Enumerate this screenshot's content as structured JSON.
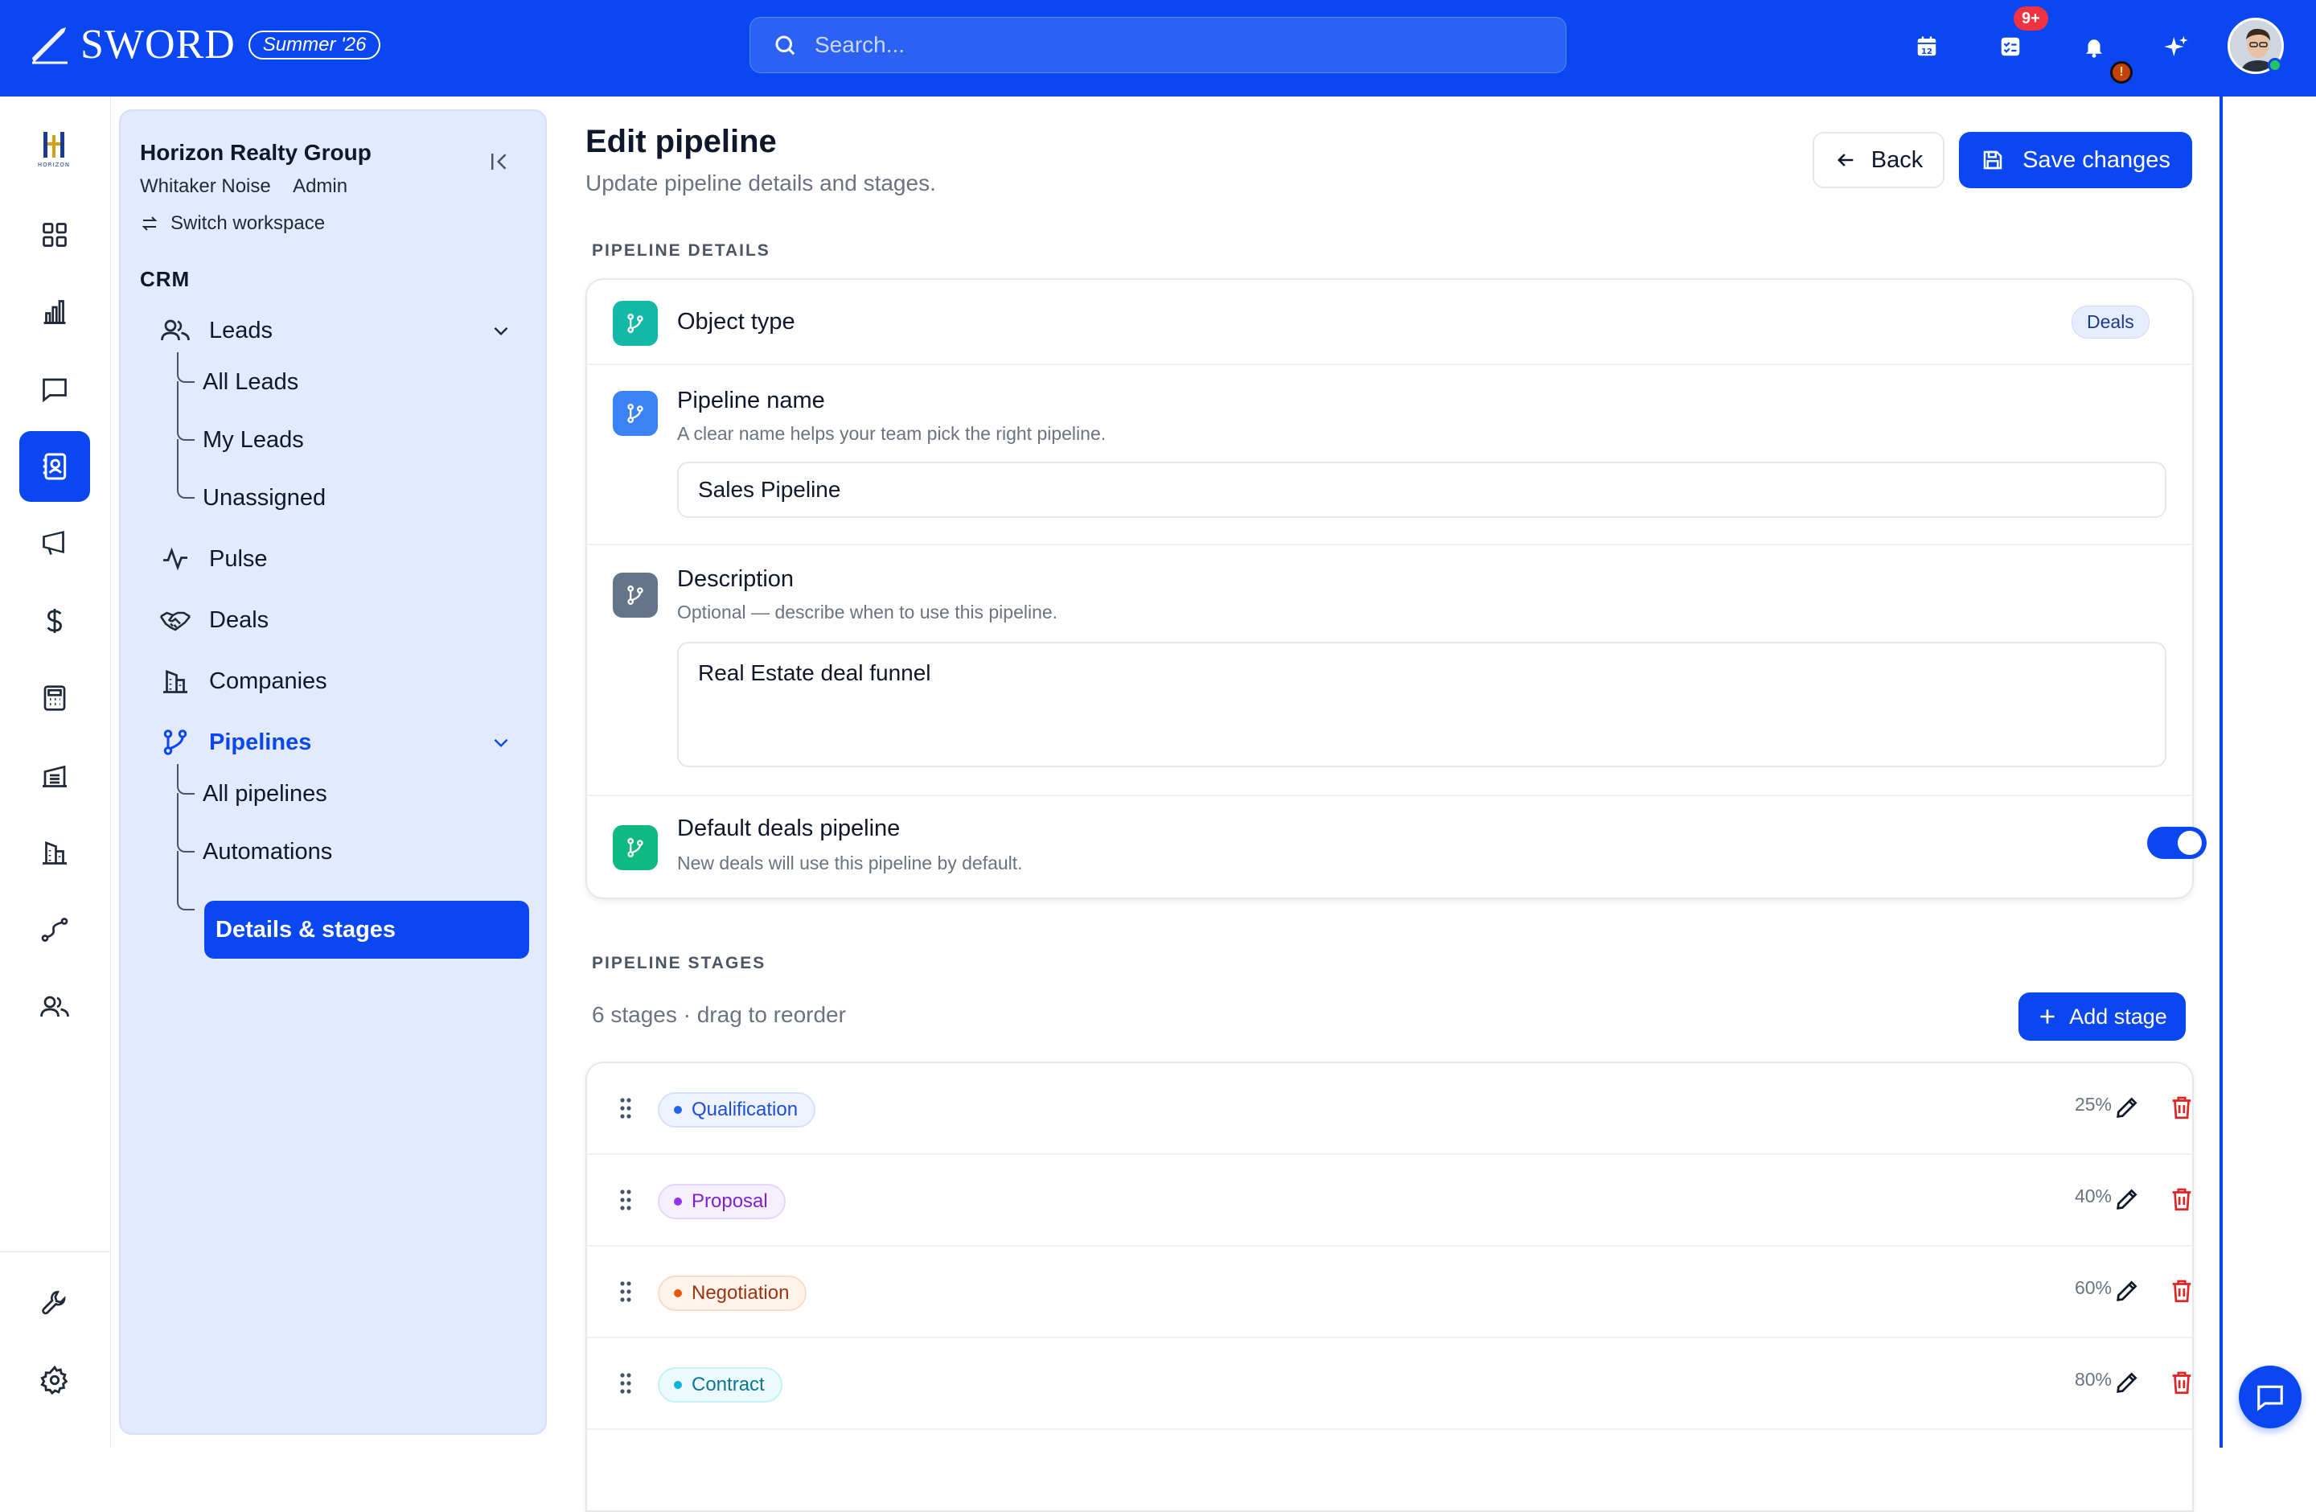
{
  "topbar": {
    "brand": "SWORD",
    "release": "Summer '26",
    "search_placeholder": "Search...",
    "calendar_day": "12",
    "tasks_badge": "9+",
    "alert_badge": "!",
    "accent": "#0a47f0"
  },
  "rail": {
    "logo_text": "HORIZON",
    "items": [
      "dashboard-icon",
      "analytics-icon",
      "messages-icon",
      "contacts-icon",
      "campaigns-icon",
      "finance-icon",
      "calculator-icon",
      "warehouse-icon",
      "buildings-icon",
      "routes-icon",
      "team-icon"
    ],
    "active": "contacts-icon",
    "bottom": [
      "tools-icon",
      "settings-icon"
    ]
  },
  "workspace": {
    "name": "Horizon Realty Group",
    "user": "Whitaker Noise",
    "role": "Admin",
    "switch_label": "Switch workspace",
    "section": "CRM",
    "nav": {
      "leads": "Leads",
      "leads_children": [
        "All Leads",
        "My Leads",
        "Unassigned"
      ],
      "pulse": "Pulse",
      "deals": "Deals",
      "companies": "Companies",
      "pipelines": "Pipelines",
      "pipelines_children": [
        "All pipelines",
        "Automations",
        "Details & stages"
      ]
    }
  },
  "page": {
    "title": "Edit pipeline",
    "subtitle": "Update pipeline details and stages.",
    "back_label": "Back",
    "save_label": "Save changes",
    "details_label": "PIPELINE DETAILS",
    "object_type_label": "Object type",
    "object_type_value": "Deals",
    "name_label": "Pipeline name",
    "name_help": "A clear name helps your team pick the right pipeline.",
    "name_value": "Sales Pipeline",
    "desc_label": "Description",
    "desc_help": "Optional — describe when to use this pipeline.",
    "desc_value": "Real Estate deal funnel",
    "default_label": "Default deals pipeline",
    "default_help": "New deals will use this pipeline by default.",
    "default_on": true,
    "stages_label": "PIPELINE STAGES",
    "stages_meta": "6 stages · drag to reorder",
    "add_stage_label": "Add stage",
    "stages": [
      {
        "name": "Qualification",
        "probability": "25%",
        "color": "#2563eb"
      },
      {
        "name": "Proposal",
        "probability": "40%",
        "color": "#9333ea"
      },
      {
        "name": "Negotiation",
        "probability": "60%",
        "color": "#ea580c"
      },
      {
        "name": "Contract",
        "probability": "80%",
        "color": "#06b6d4"
      }
    ]
  }
}
